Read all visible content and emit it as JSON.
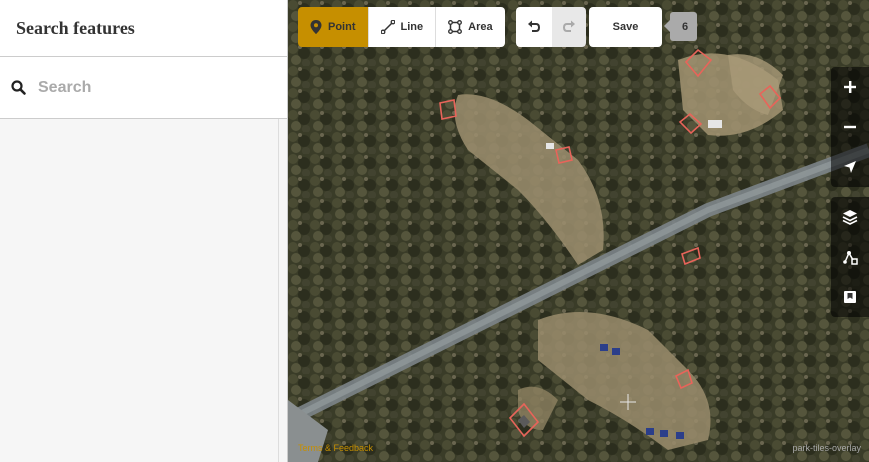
{
  "sidebar": {
    "title": "Search features",
    "search": {
      "placeholder": "Search",
      "value": ""
    }
  },
  "toolbar": {
    "modes": [
      {
        "label": "Point",
        "icon": "map-marker-icon",
        "active": true
      },
      {
        "label": "Line",
        "icon": "line-icon",
        "active": false
      },
      {
        "label": "Area",
        "icon": "area-icon",
        "active": false
      }
    ],
    "undo_icon": "undo-icon",
    "redo_icon": "redo-icon",
    "save_label": "Save",
    "save_count": "6"
  },
  "map": {
    "controls": [
      "zoom-in-icon",
      "zoom-out-icon",
      "geolocate-icon",
      "layers-icon",
      "map-data-icon",
      "help-icon"
    ],
    "attribution": "Terms & Feedback",
    "overlay_label": "park-tiles-overlay"
  },
  "colors": {
    "accent": "#c68f00",
    "feature_outline": "#e8645a",
    "sidebar_bg": "#f6f6f6"
  }
}
